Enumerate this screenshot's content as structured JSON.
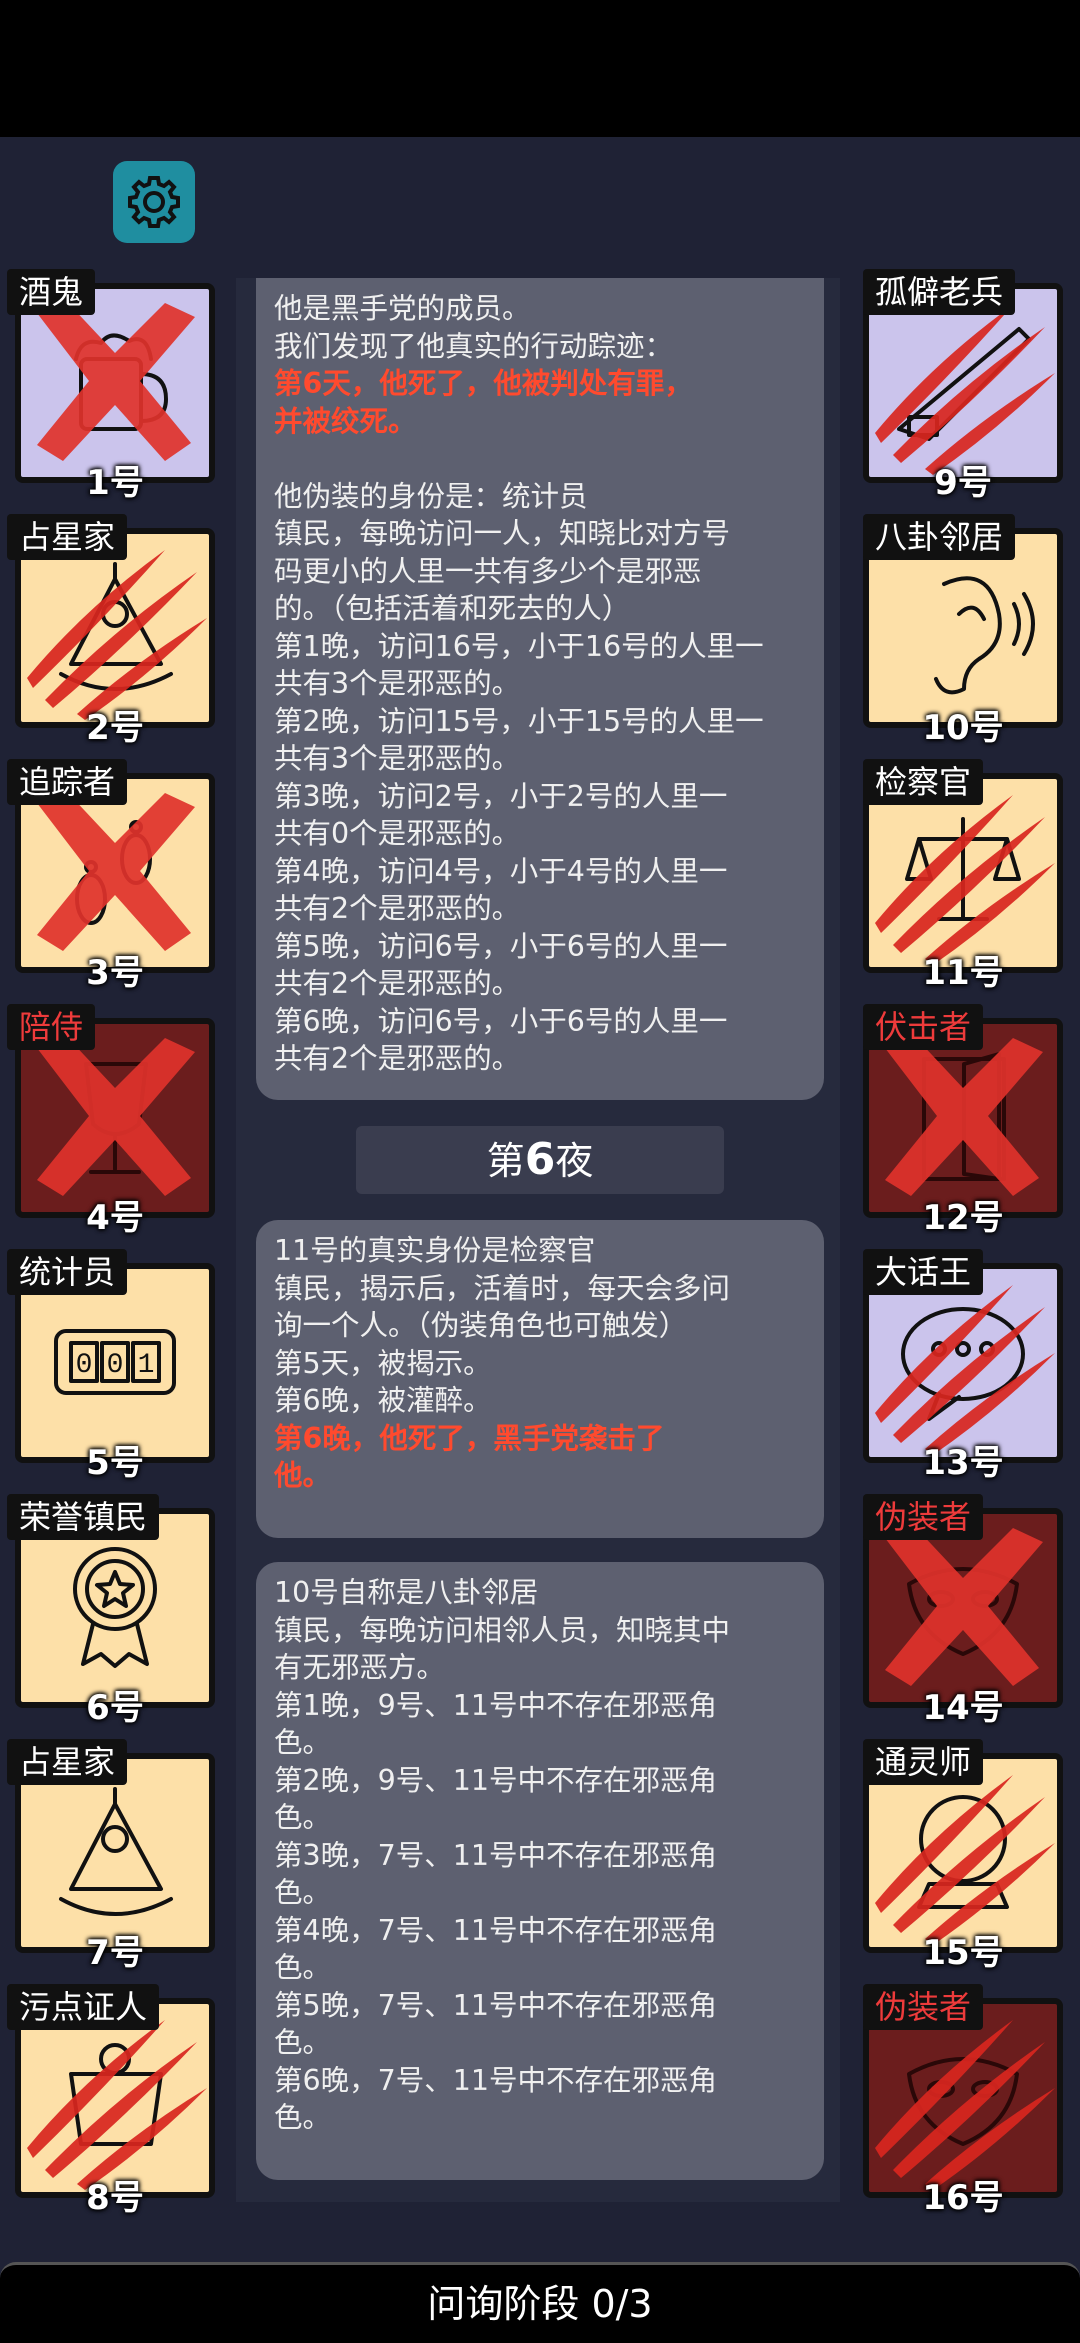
{
  "settings_icon": "gear-icon",
  "left_cards": [
    {
      "name": "酒鬼",
      "num": "1号",
      "bg": "lav",
      "status": "x",
      "icon": "beer-mug-icon",
      "red_name": false
    },
    {
      "name": "占星家",
      "num": "2号",
      "bg": "cream",
      "status": "claw",
      "icon": "sextant-icon",
      "red_name": false
    },
    {
      "name": "追踪者",
      "num": "3号",
      "bg": "cream",
      "status": "x",
      "icon": "footprints-icon",
      "red_name": false
    },
    {
      "name": "陪侍",
      "num": "4号",
      "bg": "maroon",
      "status": "x",
      "icon": "wine-glass-icon",
      "red_name": true
    },
    {
      "name": "统计员",
      "num": "5号",
      "bg": "cream",
      "status": "none",
      "icon": "counter-icon",
      "red_name": false
    },
    {
      "name": "荣誉镇民",
      "num": "6号",
      "bg": "cream",
      "status": "none",
      "icon": "medal-icon",
      "red_name": false
    },
    {
      "name": "占星家",
      "num": "7号",
      "bg": "cream",
      "status": "none",
      "icon": "sextant-icon",
      "red_name": false
    },
    {
      "name": "污点证人",
      "num": "8号",
      "bg": "cream",
      "status": "claw",
      "icon": "witness-icon",
      "red_name": false
    }
  ],
  "right_cards": [
    {
      "name": "孤僻老兵",
      "num": "9号",
      "bg": "lav",
      "status": "claw",
      "icon": "rifle-icon",
      "red_name": false
    },
    {
      "name": "八卦邻居",
      "num": "10号",
      "bg": "cream",
      "status": "none",
      "icon": "ear-icon",
      "red_name": false
    },
    {
      "name": "检察官",
      "num": "11号",
      "bg": "cream",
      "status": "claw",
      "icon": "scales-icon",
      "red_name": false
    },
    {
      "name": "伏击者",
      "num": "12号",
      "bg": "maroon",
      "status": "x",
      "icon": "door-icon",
      "red_name": true
    },
    {
      "name": "大话王",
      "num": "13号",
      "bg": "lav",
      "status": "claw",
      "icon": "bubble-icon",
      "red_name": false
    },
    {
      "name": "伪装者",
      "num": "14号",
      "bg": "maroon",
      "status": "x",
      "icon": "mask-icon",
      "red_name": true
    },
    {
      "name": "通灵师",
      "num": "15号",
      "bg": "cream",
      "status": "claw",
      "icon": "crystal-ball-icon",
      "red_name": false
    },
    {
      "name": "伪装者",
      "num": "16号",
      "bg": "maroon",
      "status": "claw",
      "icon": "mask-icon",
      "red_name": true
    }
  ],
  "msg1": {
    "lines": [
      {
        "t": "他是黑手党的成员。",
        "red": false
      },
      {
        "t": "我们发现了他真实的行动踪迹：",
        "red": false
      },
      {
        "t": "第6天，他死了，他被判处有罪，",
        "red": true
      },
      {
        "t": "并被绞死。",
        "red": true
      },
      {
        "t": "",
        "red": false
      },
      {
        "t": "他伪装的身份是：统计员",
        "red": false
      },
      {
        "t": "镇民，每晚访问一人，知晓比对方号",
        "red": false
      },
      {
        "t": "码更小的人里一共有多少个是邪恶",
        "red": false
      },
      {
        "t": "的。（包括活着和死去的人）",
        "red": false
      },
      {
        "t": "第1晚，访问16号，小于16号的人里一",
        "red": false
      },
      {
        "t": "共有3个是邪恶的。",
        "red": false
      },
      {
        "t": "第2晚，访问15号，小于15号的人里一",
        "red": false
      },
      {
        "t": "共有3个是邪恶的。",
        "red": false
      },
      {
        "t": "第3晚，访问2号，小于2号的人里一",
        "red": false
      },
      {
        "t": "共有0个是邪恶的。",
        "red": false
      },
      {
        "t": "第4晚，访问4号，小于4号的人里一",
        "red": false
      },
      {
        "t": "共有2个是邪恶的。",
        "red": false
      },
      {
        "t": "第5晚，访问6号，小于6号的人里一",
        "red": false
      },
      {
        "t": "共有2个是邪恶的。",
        "red": false
      },
      {
        "t": "第6晚，访问6号，小于6号的人里一",
        "red": false
      },
      {
        "t": "共有2个是邪恶的。",
        "red": false
      }
    ]
  },
  "night_label": {
    "prefix": "第",
    "num": "6",
    "suffix": "夜"
  },
  "msg2": {
    "lines": [
      {
        "t": "11号的真实身份是检察官",
        "red": false
      },
      {
        "t": "镇民，揭示后，活着时，每天会多问",
        "red": false
      },
      {
        "t": "询一个人。（伪装角色也可触发）",
        "red": false
      },
      {
        "t": "第5天，被揭示。",
        "red": false
      },
      {
        "t": "第6晚，被灌醉。",
        "red": false
      },
      {
        "t": "第6晚，他死了，黑手党袭击了",
        "red": true
      },
      {
        "t": "他。",
        "red": true
      }
    ]
  },
  "msg3": {
    "lines": [
      {
        "t": "10号自称是八卦邻居",
        "red": false
      },
      {
        "t": "镇民，每晚访问相邻人员，知晓其中",
        "red": false
      },
      {
        "t": "有无邪恶方。",
        "red": false
      },
      {
        "t": "第1晚，9号、11号中不存在邪恶角",
        "red": false
      },
      {
        "t": "色。",
        "red": false
      },
      {
        "t": "第2晚，9号、11号中不存在邪恶角",
        "red": false
      },
      {
        "t": "色。",
        "red": false
      },
      {
        "t": "第3晚，7号、11号中不存在邪恶角",
        "red": false
      },
      {
        "t": "色。",
        "red": false
      },
      {
        "t": "第4晚，7号、11号中不存在邪恶角",
        "red": false
      },
      {
        "t": "色。",
        "red": false
      },
      {
        "t": "第5晚，7号、11号中不存在邪恶角",
        "red": false
      },
      {
        "t": "色。",
        "red": false
      },
      {
        "t": "第6晚，7号、11号中不存在邪恶角",
        "red": false
      },
      {
        "t": "色。",
        "red": false
      }
    ]
  },
  "phase": "问询阶段 0/3",
  "colors": {
    "accent": "#1f8ea0",
    "evil_red": "#ff4a2e",
    "card_cream": "#fde0a8",
    "card_lavender": "#cbc4ec",
    "card_maroon": "#6b1d1d"
  }
}
